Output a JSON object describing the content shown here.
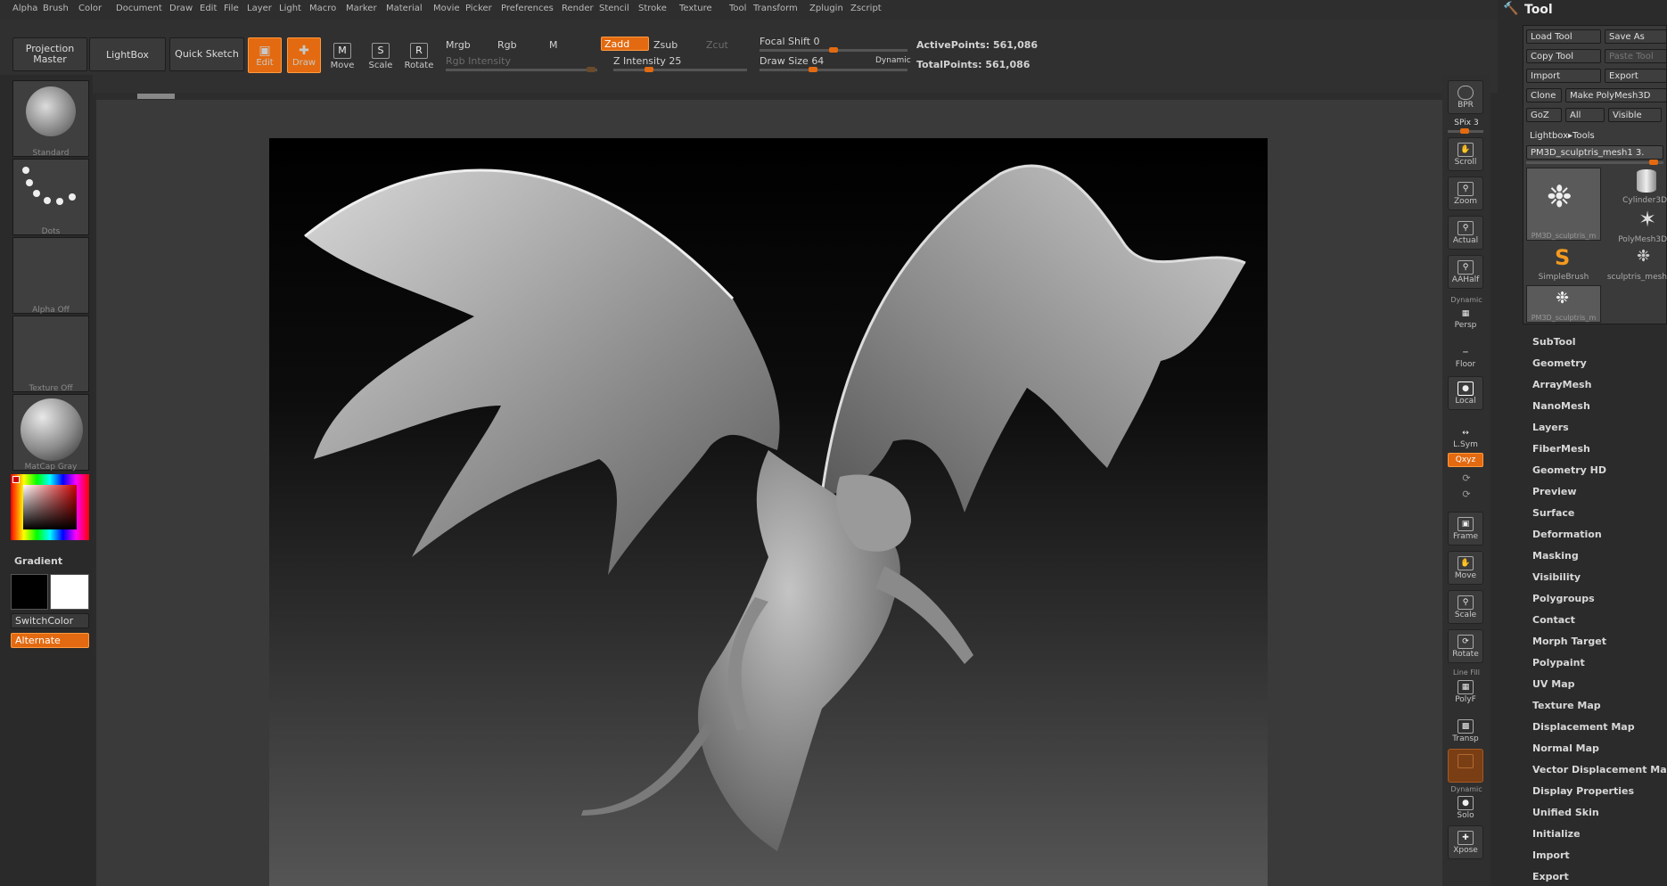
{
  "menu": [
    "Alpha",
    "Brush",
    "Color",
    "Document",
    "Draw",
    "Edit",
    "File",
    "Layer",
    "Light",
    "Macro",
    "Marker",
    "Material",
    "Movie",
    "Picker",
    "Preferences",
    "Render",
    "Stencil",
    "Stroke",
    "Texture",
    "Tool",
    "Transform",
    "Zplugin",
    "Zscript"
  ],
  "shelf": {
    "projection_master": "Projection Master",
    "lightbox": "LightBox",
    "quick_sketch": "Quick Sketch",
    "edit": "Edit",
    "draw": "Draw",
    "move": "Move",
    "scale": "Scale",
    "rotate": "Rotate",
    "move_glyph": "M",
    "scale_glyph": "S",
    "rotate_glyph": "R",
    "mrgb": "Mrgb",
    "rgb": "Rgb",
    "m": "M",
    "rgb_intensity": "Rgb Intensity",
    "zadd": "Zadd",
    "zsub": "Zsub",
    "zcut": "Zcut",
    "z_intensity_label": "Z Intensity",
    "z_intensity": "25",
    "focal_shift_label": "Focal Shift",
    "focal_shift": "0",
    "draw_size_label": "Draw Size",
    "draw_size": "64",
    "dynamic": "Dynamic",
    "active_points_label": "ActivePoints:",
    "active_points": "561,086",
    "total_points_label": "TotalPoints:",
    "total_points": "561,086",
    "z_intensity_fraction": 0.25,
    "focal_shift_fraction": 0.5,
    "draw_size_fraction": 0.35
  },
  "left": {
    "brush": "Standard",
    "stroke": "Dots",
    "alpha": "Alpha Off",
    "texture": "Texture Off",
    "material": "MatCap Gray",
    "gradient": "Gradient",
    "switch_color": "SwitchColor",
    "alternate": "Alternate"
  },
  "right_strip": {
    "bpr": "BPR",
    "spix_label": "SPix",
    "spix": "3",
    "scroll": "Scroll",
    "zoom": "Zoom",
    "actual": "Actual",
    "aahalf": "AAHalf",
    "dynamic": "Dynamic",
    "persp": "Persp",
    "floor": "Floor",
    "local": "Local",
    "lsym": "L.Sym",
    "xyz": "Qxyz",
    "frame": "Frame",
    "move": "Move",
    "scale": "Scale",
    "rotate": "Rotate",
    "line_fill": "Line Fill",
    "polyf": "PolyF",
    "transp": "Transp",
    "dynamic2": "Dynamic",
    "solo": "Solo",
    "xpose": "Xpose"
  },
  "tool": {
    "title": "Tool",
    "load_tool": "Load Tool",
    "save_as": "Save As",
    "copy_tool": "Copy Tool",
    "paste_tool": "Paste Tool",
    "import": "Import",
    "export": "Export",
    "clone": "Clone",
    "make_polymesh": "Make PolyMesh3D",
    "goz": "GoZ",
    "all": "All",
    "visible": "Visible",
    "lightbox_tools": "Lightbox▸Tools",
    "current_tool": "PM3D_sculptris_mesh1",
    "current_tool_count": "3.",
    "thumbs": [
      "PM3D_sculptris_m",
      "Cylinder3D",
      "PolyMesh3D",
      "SimpleBrush",
      "sculptris_mesh",
      "PM3D_sculptris_m"
    ],
    "sections": [
      "SubTool",
      "Geometry",
      "ArrayMesh",
      "NanoMesh",
      "Layers",
      "FiberMesh",
      "Geometry HD",
      "Preview",
      "Surface",
      "Deformation",
      "Masking",
      "Visibility",
      "Polygroups",
      "Contact",
      "Morph Target",
      "Polypaint",
      "UV Map",
      "Texture Map",
      "Displacement Map",
      "Normal Map",
      "Vector Displacement Map",
      "Display Properties",
      "Unified Skin",
      "Initialize",
      "Import",
      "Export"
    ]
  }
}
